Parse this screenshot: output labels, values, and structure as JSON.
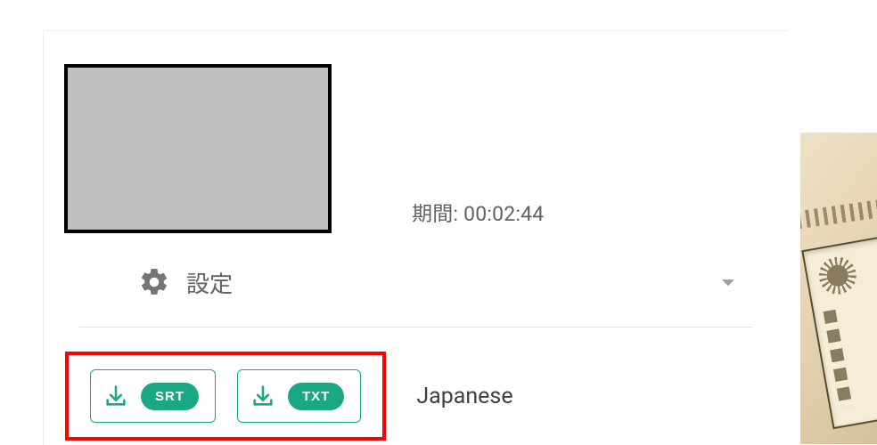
{
  "duration": {
    "label": "期間",
    "value": "00:02:44"
  },
  "settings": {
    "label": "設定"
  },
  "downloads": {
    "language": "Japanese",
    "buttons": [
      {
        "format": "SRT"
      },
      {
        "format": "TXT"
      }
    ]
  }
}
